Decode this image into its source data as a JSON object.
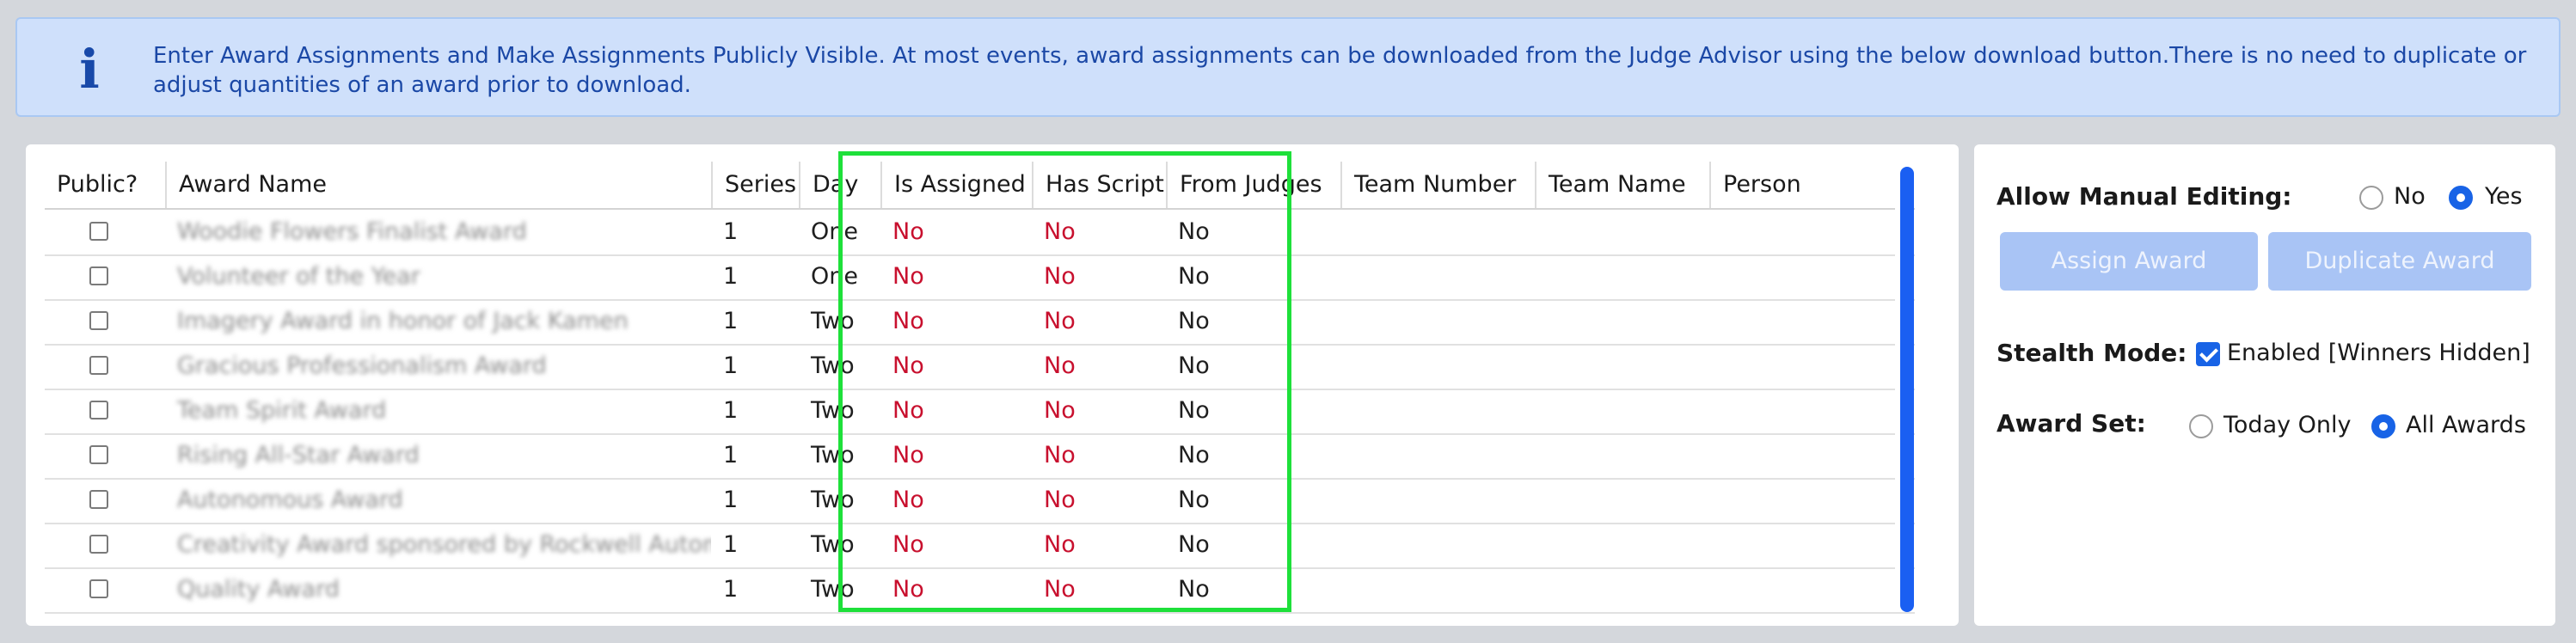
{
  "banner": {
    "icon": "info-icon",
    "text": "Enter Award Assignments and Make Assignments Publicly Visible. At most events, award assignments can be downloaded from the Judge Advisor using the below download button.There is no need to duplicate or adjust quantities of an award prior to download."
  },
  "table": {
    "headers": {
      "public": "Public?",
      "name": "Award Name",
      "series": "Series",
      "day": "Day",
      "assigned": "Is Assigned",
      "script": "Has Script",
      "judges": "From Judges",
      "team_number": "Team Number",
      "team_name": "Team Name",
      "person": "Person"
    },
    "rows": [
      {
        "name": "Woodie Flowers Finalist Award",
        "series": "1",
        "day": "One",
        "assigned": "No",
        "script": "No",
        "judges": "No"
      },
      {
        "name": "Volunteer of the Year",
        "series": "1",
        "day": "One",
        "assigned": "No",
        "script": "No",
        "judges": "No"
      },
      {
        "name": "Imagery Award in honor of Jack Kamen",
        "series": "1",
        "day": "Two",
        "assigned": "No",
        "script": "No",
        "judges": "No"
      },
      {
        "name": "Gracious Professionalism Award",
        "series": "1",
        "day": "Two",
        "assigned": "No",
        "script": "No",
        "judges": "No"
      },
      {
        "name": "Team Spirit Award",
        "series": "1",
        "day": "Two",
        "assigned": "No",
        "script": "No",
        "judges": "No"
      },
      {
        "name": "Rising All-Star Award",
        "series": "1",
        "day": "Two",
        "assigned": "No",
        "script": "No",
        "judges": "No"
      },
      {
        "name": "Autonomous Award",
        "series": "1",
        "day": "Two",
        "assigned": "No",
        "script": "No",
        "judges": "No"
      },
      {
        "name": "Creativity Award sponsored by Rockwell Automation",
        "series": "1",
        "day": "Two",
        "assigned": "No",
        "script": "No",
        "judges": "No"
      },
      {
        "name": "Quality Award",
        "series": "1",
        "day": "Two",
        "assigned": "No",
        "script": "No",
        "judges": "No"
      }
    ]
  },
  "side": {
    "manual_editing_label": "Allow Manual Editing:",
    "manual_no": "No",
    "manual_yes": "Yes",
    "manual_selected": "Yes",
    "assign_button": "Assign Award",
    "duplicate_button": "Duplicate Award",
    "stealth_label": "Stealth Mode:",
    "stealth_option": "Enabled [Winners Hidden]",
    "stealth_checked": true,
    "award_set_label": "Award Set:",
    "award_today": "Today Only",
    "award_all": "All Awards",
    "award_selected": "All Awards"
  },
  "colors": {
    "accent": "#1863e6",
    "no_value": "#c8102e",
    "highlight": "#1ee03a",
    "banner_text": "#1b48a6"
  }
}
